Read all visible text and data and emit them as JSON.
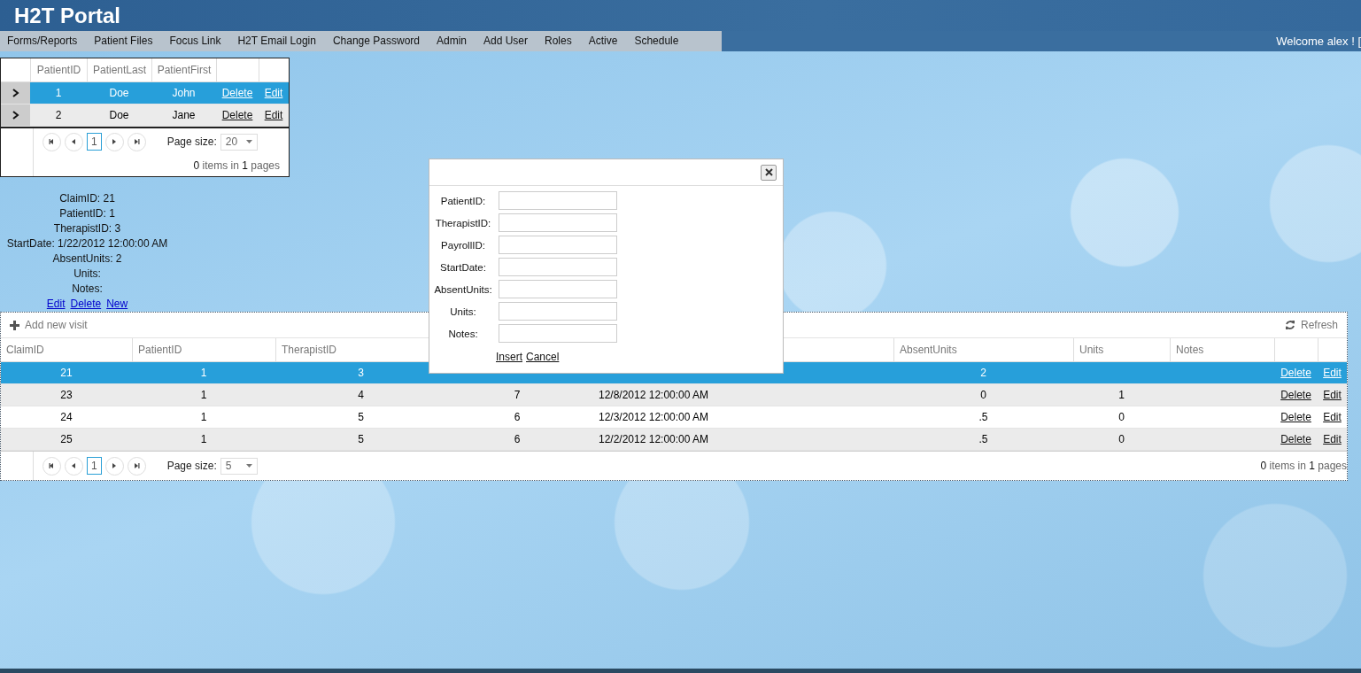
{
  "header": {
    "title": "H2T Portal",
    "welcome": "Welcome alex ! ["
  },
  "nav": [
    {
      "label": "Forms/Reports"
    },
    {
      "label": "Patient Files"
    },
    {
      "label": "Focus Link"
    },
    {
      "label": "H2T Email Login"
    },
    {
      "label": "Change Password"
    },
    {
      "label": "Admin"
    },
    {
      "label": "Add User"
    },
    {
      "label": "Roles"
    },
    {
      "label": "Active"
    },
    {
      "label": "Schedule"
    }
  ],
  "patients_grid": {
    "columns": [
      "PatientID",
      "PatientLast",
      "PatientFirst"
    ],
    "rows": [
      {
        "patient_id": "1",
        "last": "Doe",
        "first": "John",
        "selected": true,
        "delete": "Delete",
        "edit": "Edit"
      },
      {
        "patient_id": "2",
        "last": "Doe",
        "first": "Jane",
        "selected": false,
        "delete": "Delete",
        "edit": "Edit"
      }
    ],
    "pager": {
      "page": "1",
      "page_size_label": "Page size:",
      "page_size": "20",
      "summary": "**0** items in **1** pages"
    }
  },
  "claim_detail": {
    "lines": [
      "ClaimID: 21",
      "PatientID: 1",
      "TherapistID: 3",
      "StartDate: 1/22/2012 12:00:00 AM",
      "AbsentUnits: 2",
      "Units:",
      "Notes:"
    ],
    "links": [
      "Edit",
      "Delete",
      "New"
    ]
  },
  "visits_grid": {
    "toolbar": {
      "add": "Add new visit",
      "refresh": "Refresh"
    },
    "columns_left": [
      "ClaimID",
      "PatientID",
      "TherapistID"
    ],
    "columns_right": [
      "AbsentUnits",
      "Units",
      "Notes"
    ],
    "rows": [
      {
        "claim_id": "21",
        "patient_id": "1",
        "therapist_id": "3",
        "absent_units": "2",
        "selected": true,
        "delete": "Delete",
        "edit": "Edit"
      },
      {
        "claim_id": "23",
        "patient_id": "1",
        "therapist_id": "4",
        "column_4": "7",
        "column_5": "12/8/2012 12:00:00 AM",
        "absent_units": "0",
        "units": "1",
        "selected": false,
        "delete": "Delete",
        "edit": "Edit"
      },
      {
        "claim_id": "24",
        "patient_id": "1",
        "therapist_id": "5",
        "column_4": "6",
        "column_5": "12/3/2012 12:00:00 AM",
        "absent_units": ".5",
        "units": "0",
        "selected": false,
        "delete": "Delete",
        "edit": "Edit"
      },
      {
        "claim_id": "25",
        "patient_id": "1",
        "therapist_id": "5",
        "column_4": "6",
        "column_5": "12/2/2012 12:00:00 AM",
        "absent_units": ".5",
        "units": "0",
        "selected": false,
        "delete": "Delete",
        "edit": "Edit"
      }
    ],
    "pager": {
      "page": "1",
      "page_size_label": "Page size:",
      "page_size": "5",
      "summary": "**0** items in **1** pages"
    }
  },
  "dialog": {
    "fields": [
      {
        "label": "PatientID:"
      },
      {
        "label": "TherapistID:"
      },
      {
        "label": "PayrollID:"
      },
      {
        "label": "StartDate:"
      },
      {
        "label": "AbsentUnits:"
      },
      {
        "label": "Units:"
      },
      {
        "label": "Notes:"
      }
    ],
    "actions": [
      "Insert",
      "Cancel"
    ]
  }
}
